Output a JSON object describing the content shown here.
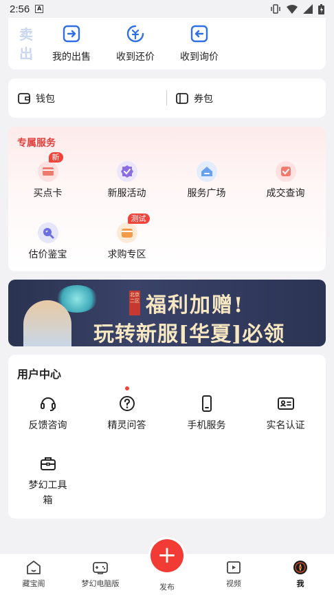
{
  "status": {
    "time": "2:56"
  },
  "sell": {
    "vertical_label": "卖出",
    "items": [
      {
        "label": "我的出售",
        "icon": "my-sales-icon"
      },
      {
        "label": "收到还价",
        "icon": "counter-offer-icon"
      },
      {
        "label": "收到询价",
        "icon": "inquiry-icon"
      }
    ]
  },
  "wallet": {
    "wallet_label": "钱包",
    "coupon_label": "券包"
  },
  "exclusive": {
    "title": "专属服务",
    "items": [
      {
        "label": "买点卡",
        "tag": "新"
      },
      {
        "label": "新服活动",
        "tag": ""
      },
      {
        "label": "服务广场",
        "tag": ""
      },
      {
        "label": "成交查询",
        "tag": ""
      },
      {
        "label": "估价鉴宝",
        "tag": ""
      },
      {
        "label": "求购专区",
        "tag": "测试"
      }
    ]
  },
  "banner": {
    "seal": "北京二区",
    "line1": "福利加赠!",
    "line2": "玩转新服[华夏]必领"
  },
  "user_center": {
    "title": "用户中心",
    "items": [
      {
        "label": "反馈咨询"
      },
      {
        "label": "精灵问答"
      },
      {
        "label": "手机服务"
      },
      {
        "label": "实名认证"
      },
      {
        "label": "梦幻工具",
        "label2": "箱"
      }
    ]
  },
  "nav": {
    "items": [
      {
        "label": "藏宝阁"
      },
      {
        "label": "梦幻电脑版"
      },
      {
        "label": "发布"
      },
      {
        "label": "视频"
      },
      {
        "label": "我"
      }
    ],
    "active": "我"
  },
  "colors": {
    "accent": "#f23b34",
    "sell_blue": "#2f6fe4",
    "tag_red": "#f0433a"
  }
}
